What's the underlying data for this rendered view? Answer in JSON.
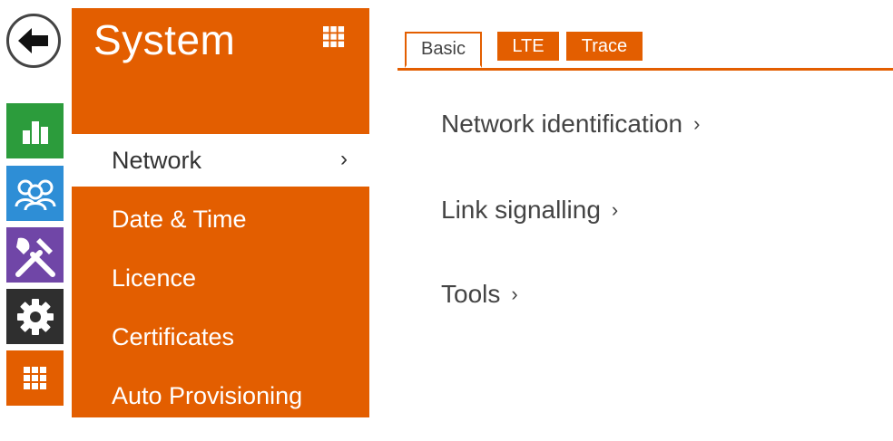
{
  "rail": {
    "back_icon": "arrow-left-icon",
    "items": [
      {
        "icon": "bar-chart-icon",
        "color": "#2c9c3c"
      },
      {
        "icon": "users-icon",
        "color": "#2e8ed6"
      },
      {
        "icon": "tools-icon",
        "color": "#7046a7"
      },
      {
        "icon": "gear-icon",
        "color": "#2f2f2f"
      },
      {
        "icon": "apps-grid-icon",
        "color": "#e35e00"
      }
    ]
  },
  "menu": {
    "title": "System",
    "items": [
      {
        "label": "Network",
        "active": true,
        "chevron": "›"
      },
      {
        "label": "Date & Time"
      },
      {
        "label": "Licence"
      },
      {
        "label": "Certificates"
      },
      {
        "label": "Auto Provisioning"
      }
    ]
  },
  "tabs": [
    {
      "label": "Basic",
      "active": true
    },
    {
      "label": "LTE"
    },
    {
      "label": "Trace"
    }
  ],
  "content": {
    "links": [
      {
        "label": "Network identification",
        "arrow": "›"
      },
      {
        "label": "Link signalling",
        "arrow": "›"
      },
      {
        "label": "Tools",
        "arrow": "›"
      }
    ]
  },
  "colors": {
    "accent": "#e35e00"
  }
}
